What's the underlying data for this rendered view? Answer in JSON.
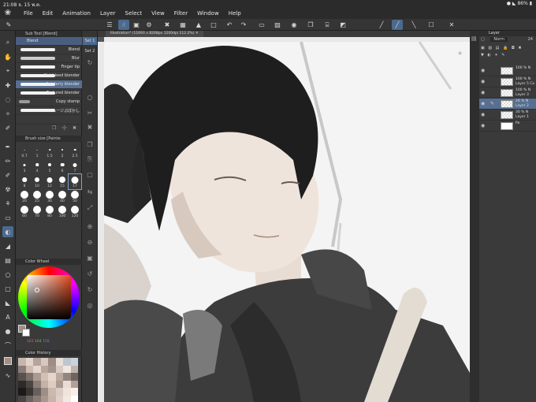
{
  "status": {
    "time": "21:08",
    "date": "จ. 15 พ.ค.",
    "battery": "86%"
  },
  "menu": [
    "File",
    "Edit",
    "Animation",
    "Layer",
    "Select",
    "View",
    "Filter",
    "Window",
    "Help"
  ],
  "subtool": {
    "header": "Sub Tool [Blend]",
    "category": "Blend",
    "items": [
      {
        "label": "Blend"
      },
      {
        "label": "Blur"
      },
      {
        "label": "Finger tip"
      },
      {
        "label": "Not bleed blender"
      },
      {
        "label": "Painterly blender"
      },
      {
        "label": "Textured blender"
      },
      {
        "label": "Copy stamp"
      },
      {
        "label": "スムージぷぼかし"
      }
    ],
    "selected": "Painterly blender"
  },
  "brush_size": {
    "header": "Brush size [Painte",
    "sizes": [
      "0.7",
      "1",
      "1.5",
      "2",
      "2.5",
      "3",
      "4",
      "5",
      "6",
      "7",
      "8",
      "10",
      "12",
      "15",
      "17",
      "20",
      "25",
      "30",
      "40",
      "50",
      "60",
      "70",
      "80",
      "100",
      "120"
    ],
    "selected": "17"
  },
  "color_wheel": {
    "header": "Color Wheel",
    "rgb": [
      "163",
      "164",
      "158"
    ],
    "main_color": "#a38f84",
    "sub_color": "#ffffff"
  },
  "color_history": {
    "header": "Color History",
    "swatches": [
      "#c8b6ab",
      "#e2d4cc",
      "#b7a49a",
      "#d6c8c0",
      "#9f8c82",
      "#e9dfd9",
      "#bfc5cf",
      "#c9d3e0",
      "#8a7d78",
      "#cdbbb1",
      "#e6d7ce",
      "#b8a69c",
      "#a3948c",
      "#d9cbc4",
      "#f0e6e0",
      "#c0b3ad",
      "#5a504c",
      "#7d6f69",
      "#ab9a91",
      "#d1c0b6",
      "#e5d5cb",
      "#bba89e",
      "#92857f",
      "#6f6560",
      "#2e2a28",
      "#4b4542",
      "#8c7e77",
      "#c4b2a8",
      "#ddcdc3",
      "#a99a92",
      "#e8dcd5",
      "#b39f94",
      "#1c1a19",
      "#3a3532",
      "#6a605b",
      "#9d8e86",
      "#cbb9ae",
      "#dccbc2",
      "#efe3dc",
      "#f7efea",
      "#4a4442",
      "#6c625e",
      "#897b74",
      "#a8978e",
      "#c7b5ab",
      "#e0d0c7",
      "#f3e9e3",
      "#ffffff"
    ]
  },
  "set_tabs": [
    "Set 1",
    "Set 2"
  ],
  "document": {
    "tab": "Illustration* (11693 x 8268px 1200dpi 112.2%)"
  },
  "layer_panel": {
    "header": "Layer",
    "blend_mode": "Norm",
    "opacity": "24",
    "layers": [
      {
        "opacity": "100 %",
        "mode": "N",
        "name": "",
        "thumb": "transparent"
      },
      {
        "opacity": "100 %",
        "mode": "N",
        "name": "Layer 5 Co",
        "thumb": "transparent"
      },
      {
        "opacity": "100 %",
        "mode": "N",
        "name": "Layer 3",
        "thumb": "transparent"
      },
      {
        "opacity": "24 %",
        "mode": "N",
        "name": "Layer 2",
        "thumb": "transparent",
        "selected": true
      },
      {
        "opacity": "30 %",
        "mode": "N",
        "name": "Layer 1",
        "thumb": "transparent"
      },
      {
        "opacity": "",
        "mode": "",
        "name": "Pa",
        "thumb": "white"
      }
    ]
  }
}
